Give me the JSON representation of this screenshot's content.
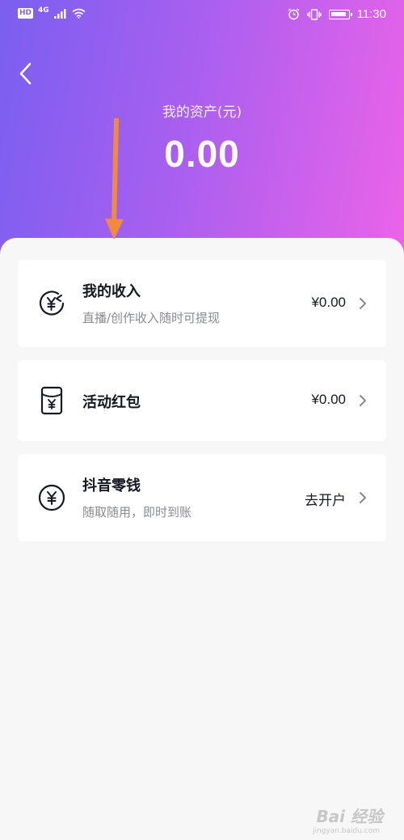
{
  "status_bar": {
    "hd": "HD",
    "network": "4G",
    "time": "11:30"
  },
  "header": {
    "asset_label": "我的资产(元)",
    "asset_value": "0.00"
  },
  "cards": [
    {
      "title": "我的收入",
      "subtitle": "直播/创作收入随时可提现",
      "value": "¥0.00"
    },
    {
      "title": "活动红包",
      "value": "¥0.00"
    },
    {
      "title": "抖音零钱",
      "subtitle": "随取随用，即时到账",
      "value": "去开户"
    }
  ],
  "watermark": {
    "text": "Bai 经验",
    "url": "jingyan.baidu.com"
  },
  "icons": {
    "back": "chevron-left-icon",
    "income": "yen-return-icon",
    "red_packet": "red-packet-icon",
    "wallet": "yen-circle-icon",
    "row_arrow": "chevron-right-icon"
  },
  "colors": {
    "gradient_start": "#7a5ff0",
    "gradient_end": "#ec63e8",
    "annotation_arrow": "#f08a3c"
  }
}
